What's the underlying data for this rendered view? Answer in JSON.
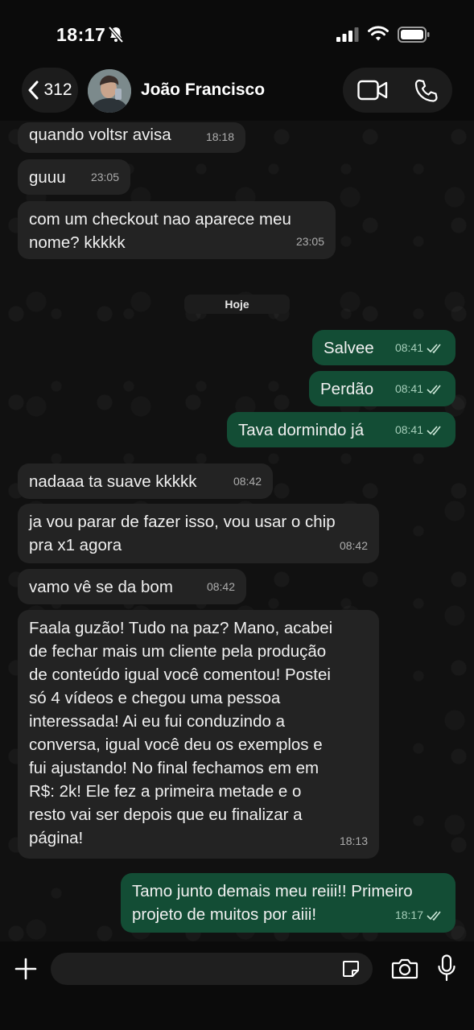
{
  "status_bar": {
    "time": "18:17"
  },
  "header": {
    "back_count": "312",
    "contact_name": "João Francisco"
  },
  "date_divider": "Hoje",
  "messages": [
    {
      "direction": "in",
      "text": "quando voltsr avisa",
      "time": "18:18"
    },
    {
      "direction": "in",
      "text": "guuu",
      "time": "23:05"
    },
    {
      "direction": "in",
      "text": "com um checkout nao aparece meu\nnome? kkkkk",
      "time": "23:05"
    },
    {
      "direction": "out",
      "text": "Salvee",
      "time": "08:41",
      "status": "read"
    },
    {
      "direction": "out",
      "text": "Perdão",
      "time": "08:41",
      "status": "read"
    },
    {
      "direction": "out",
      "text": "Tava dormindo já",
      "time": "08:41",
      "status": "read"
    },
    {
      "direction": "in",
      "text": "nadaaa ta suave kkkkk",
      "time": "08:42"
    },
    {
      "direction": "in",
      "text": "ja vou parar de fazer isso, vou usar o chip\npra x1 agora",
      "time": "08:42"
    },
    {
      "direction": "in",
      "text": "vamo vê se da bom",
      "time": "08:42"
    },
    {
      "direction": "in",
      "text": "Faala guzão! Tudo na paz? Mano, acabei\nde fechar mais um cliente pela produção\nde conteúdo igual você comentou! Postei\nsó 4 vídeos e chegou uma pessoa\ninteressada! Ai eu fui conduzindo a\nconversa, igual você deu os exemplos e\nfui ajustando! No final fechamos em em\nR$: 2k! Ele fez a primeira metade e o\nresto vai ser depois que eu finalizar a\npágina!",
      "time": "18:13"
    },
    {
      "direction": "out",
      "text": "Tamo junto demais meu reiii!! Primeiro\nprojeto de muitos por aiii!",
      "time": "18:17",
      "status": "read"
    }
  ],
  "composer": {
    "value": "",
    "placeholder": ""
  },
  "colors": {
    "incoming_bubble": "#232323",
    "outgoing_bubble": "#134d35",
    "background": "#0b0b0b"
  }
}
